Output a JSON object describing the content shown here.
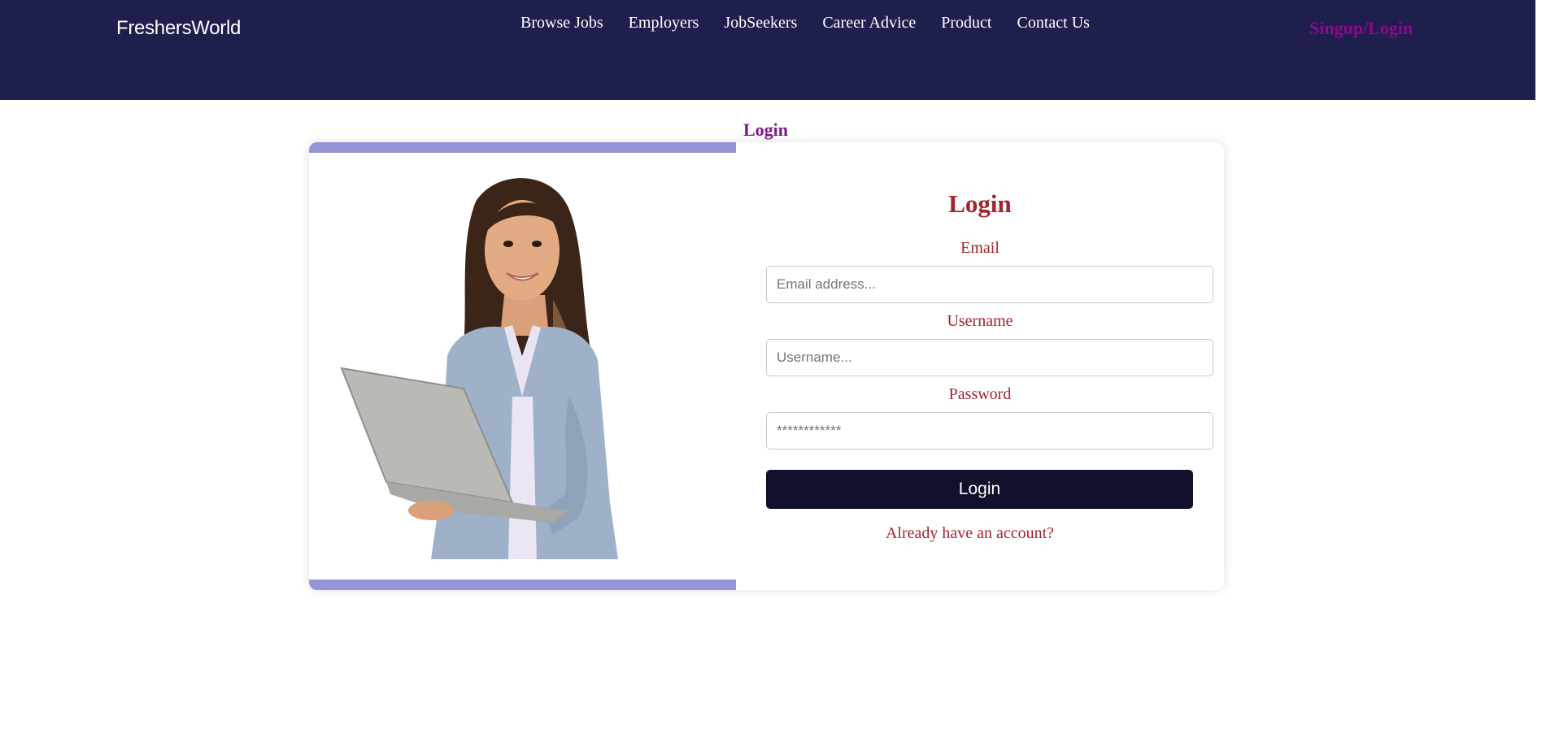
{
  "header": {
    "logo": "FreshersWorld",
    "nav": [
      "Browse Jobs",
      "Employers",
      "JobSeekers",
      "Career Advice",
      "Product",
      "Contact Us"
    ],
    "signup_login": "Singup/Login"
  },
  "page": {
    "floating_title": "Login"
  },
  "form": {
    "title": "Login",
    "email_label": "Email",
    "email_placeholder": "Email address...",
    "username_label": "Username",
    "username_placeholder": "Username...",
    "password_label": "Password",
    "password_placeholder": "************",
    "submit_label": "Login",
    "account_link": "Already have an account?"
  },
  "colors": {
    "navbar": "#1f1f4e",
    "accent_purple": "#8a0a8a",
    "form_text": "#a1242c",
    "button": "#11112e",
    "image_band": "#9494d6"
  }
}
